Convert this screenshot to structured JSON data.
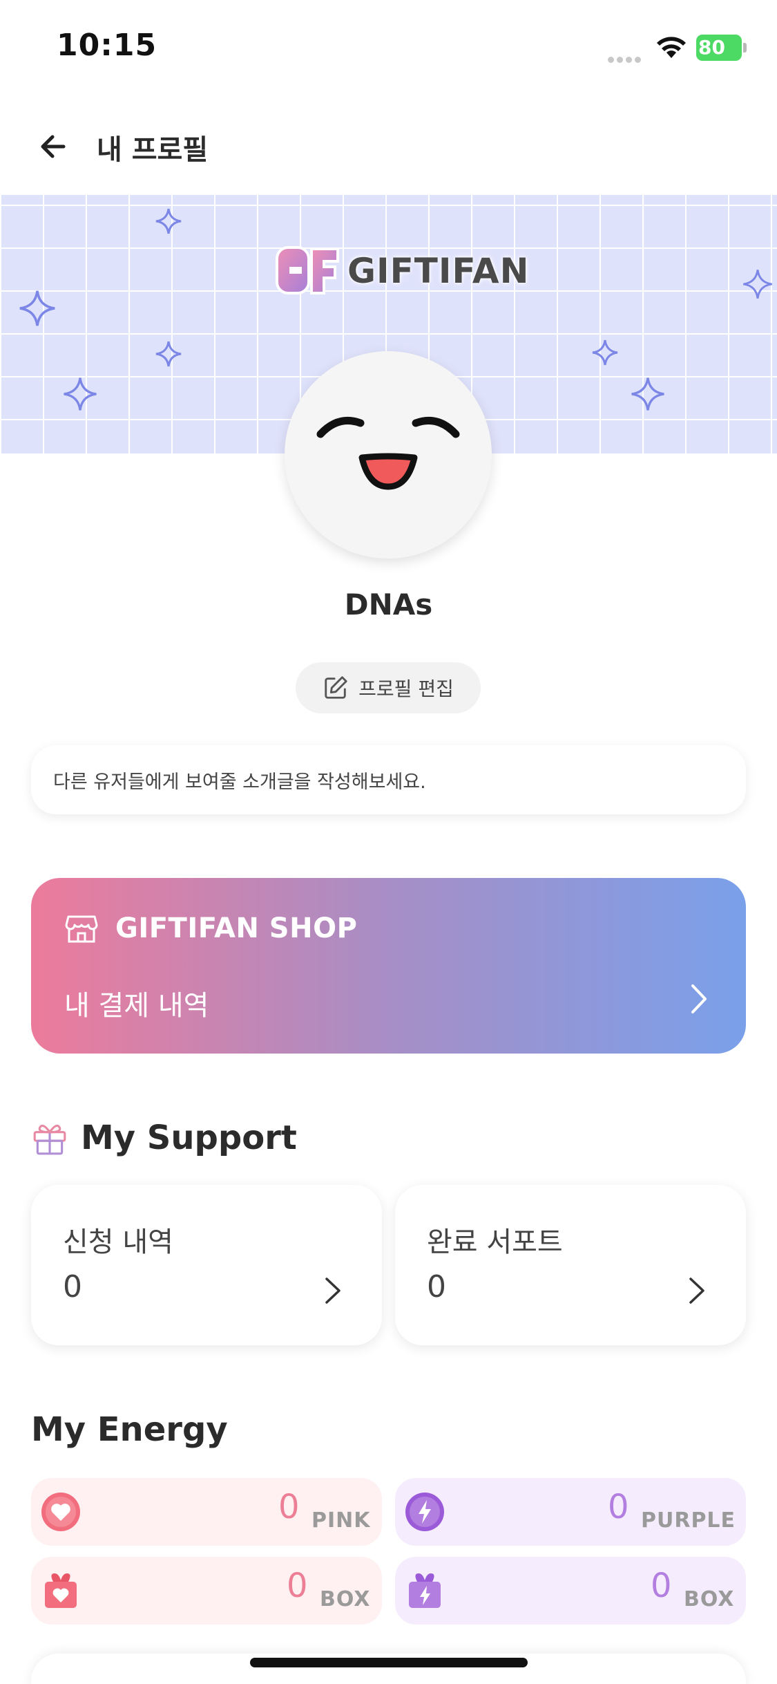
{
  "status_bar": {
    "time": "10:15",
    "battery": "80"
  },
  "header": {
    "title": "내 프로필"
  },
  "banner": {
    "brand": "GIFTIFAN"
  },
  "profile": {
    "name": "DNAs",
    "edit_label": "프로필 편집",
    "bio_placeholder": "다른 유저들에게 보여줄 소개글을 작성해보세요."
  },
  "shop": {
    "title": "GIFTIFAN SHOP",
    "subtitle": "내 결제 내역"
  },
  "support": {
    "title": "My Support",
    "cards": [
      {
        "label": "신청 내역",
        "value": "0"
      },
      {
        "label": "완료 서포트",
        "value": "0"
      }
    ]
  },
  "energy": {
    "title": "My Energy",
    "items": [
      {
        "value": "0",
        "unit": "PINK",
        "icon": "pink-heart-icon"
      },
      {
        "value": "0",
        "unit": "PURPLE",
        "icon": "purple-lightning-icon"
      },
      {
        "value": "0",
        "unit": "BOX",
        "icon": "pink-gift-box-icon"
      },
      {
        "value": "0",
        "unit": "BOX",
        "icon": "purple-gift-box-icon"
      }
    ]
  },
  "colors": {
    "banner_bg": "#dfe2fb",
    "shop_gradient_start": "#ec7b9b",
    "shop_gradient_end": "#7aa0ea",
    "pink_accent": "#ec7f95",
    "purple_accent": "#b27ee0"
  }
}
